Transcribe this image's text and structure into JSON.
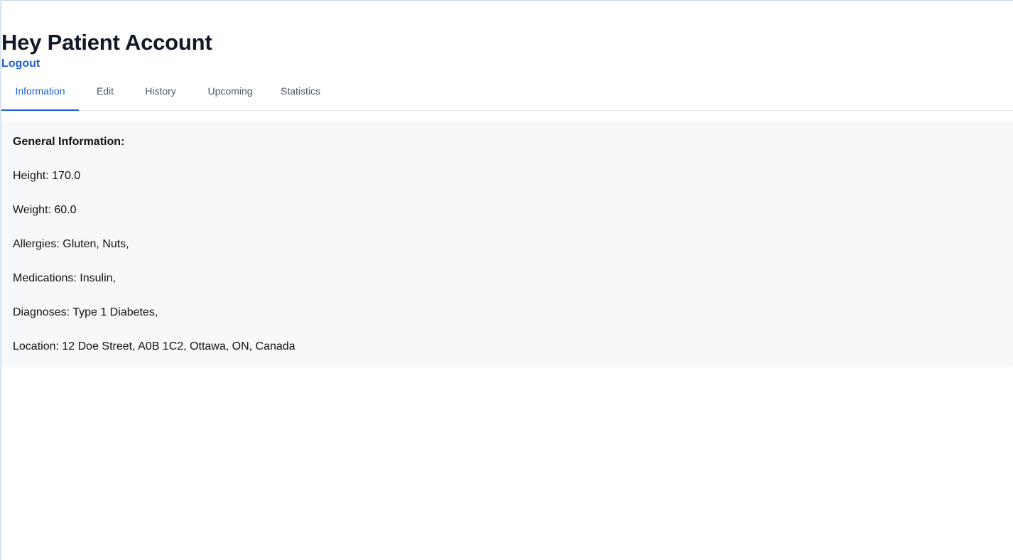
{
  "header": {
    "title": "Hey Patient Account",
    "logout_label": "Logout"
  },
  "tabs": [
    {
      "label": "Information",
      "active": true
    },
    {
      "label": "Edit",
      "active": false
    },
    {
      "label": "History",
      "active": false
    },
    {
      "label": "Upcoming",
      "active": false
    },
    {
      "label": "Statistics",
      "active": false
    }
  ],
  "info": {
    "heading": "General Information:",
    "height": "Height: 170.0",
    "weight": "Weight: 60.0",
    "allergies": "Allergies: Gluten, Nuts,",
    "medications": "Medications: Insulin,",
    "diagnoses": "Diagnoses: Type 1 Diabetes,",
    "location": "Location: 12 Doe Street, A0B 1C2, Ottawa, ON, Canada"
  },
  "colors": {
    "accent": "#1f5fd6",
    "panel_background": "#f7f8fa",
    "text": "#111827",
    "tab_inactive": "#4b5563"
  }
}
